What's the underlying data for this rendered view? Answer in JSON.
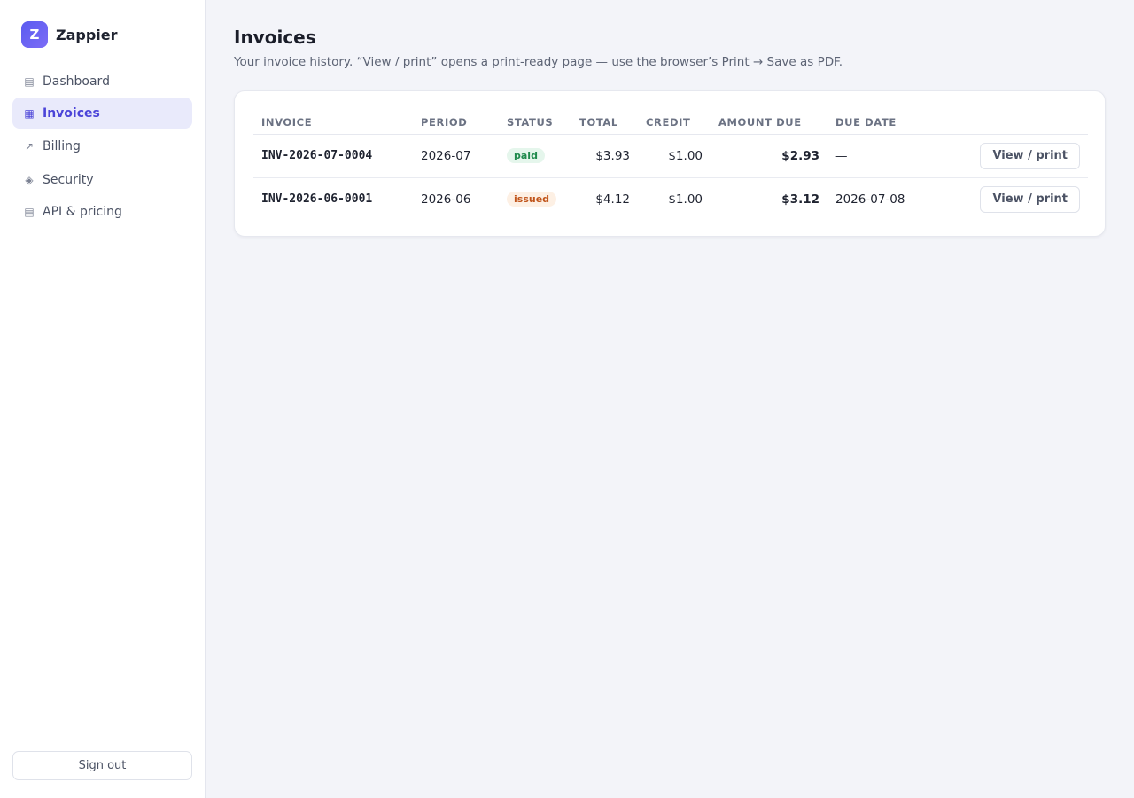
{
  "brand": {
    "logo_letter": "Z",
    "name": "Zappier",
    "accent": "#5b5cf0"
  },
  "sidebar": {
    "items": [
      {
        "label": "Dashboard",
        "icon": "▤",
        "icon_name": "dashboard-icon",
        "active": false
      },
      {
        "label": "Invoices",
        "icon": "▦",
        "icon_name": "invoices-icon",
        "active": true
      },
      {
        "label": "Billing",
        "icon": "↗",
        "icon_name": "billing-icon",
        "active": false
      },
      {
        "label": "Security",
        "icon": "◈",
        "icon_name": "security-icon",
        "active": false
      },
      {
        "label": "API & pricing",
        "icon": "▤",
        "icon_name": "api-pricing-icon",
        "active": false
      }
    ],
    "signout_label": "Sign out"
  },
  "page": {
    "title": "Invoices",
    "subtitle": "Your invoice history. “View / print” opens a print-ready page — use the browser’s Print → Save as PDF."
  },
  "table": {
    "headers": {
      "invoice": "INVOICE",
      "period": "PERIOD",
      "status": "STATUS",
      "total": "TOTAL",
      "credit": "CREDIT",
      "amount_due": "AMOUNT DUE",
      "due_date": "DUE DATE"
    },
    "rows": [
      {
        "invoice": "INV-2026-07-0004",
        "period": "2026-07",
        "status": "paid",
        "total": "$3.93",
        "credit": "$1.00",
        "amount_due": "$2.93",
        "due_date": "—",
        "action": "View / print"
      },
      {
        "invoice": "INV-2026-06-0001",
        "period": "2026-06",
        "status": "issued",
        "total": "$4.12",
        "credit": "$1.00",
        "amount_due": "$3.12",
        "due_date": "2026-07-08",
        "action": "View / print"
      }
    ]
  },
  "colors": {
    "paid_badge": "#1f8a4c",
    "issued_badge": "#c0541a",
    "active_nav": "#4b44d8"
  }
}
